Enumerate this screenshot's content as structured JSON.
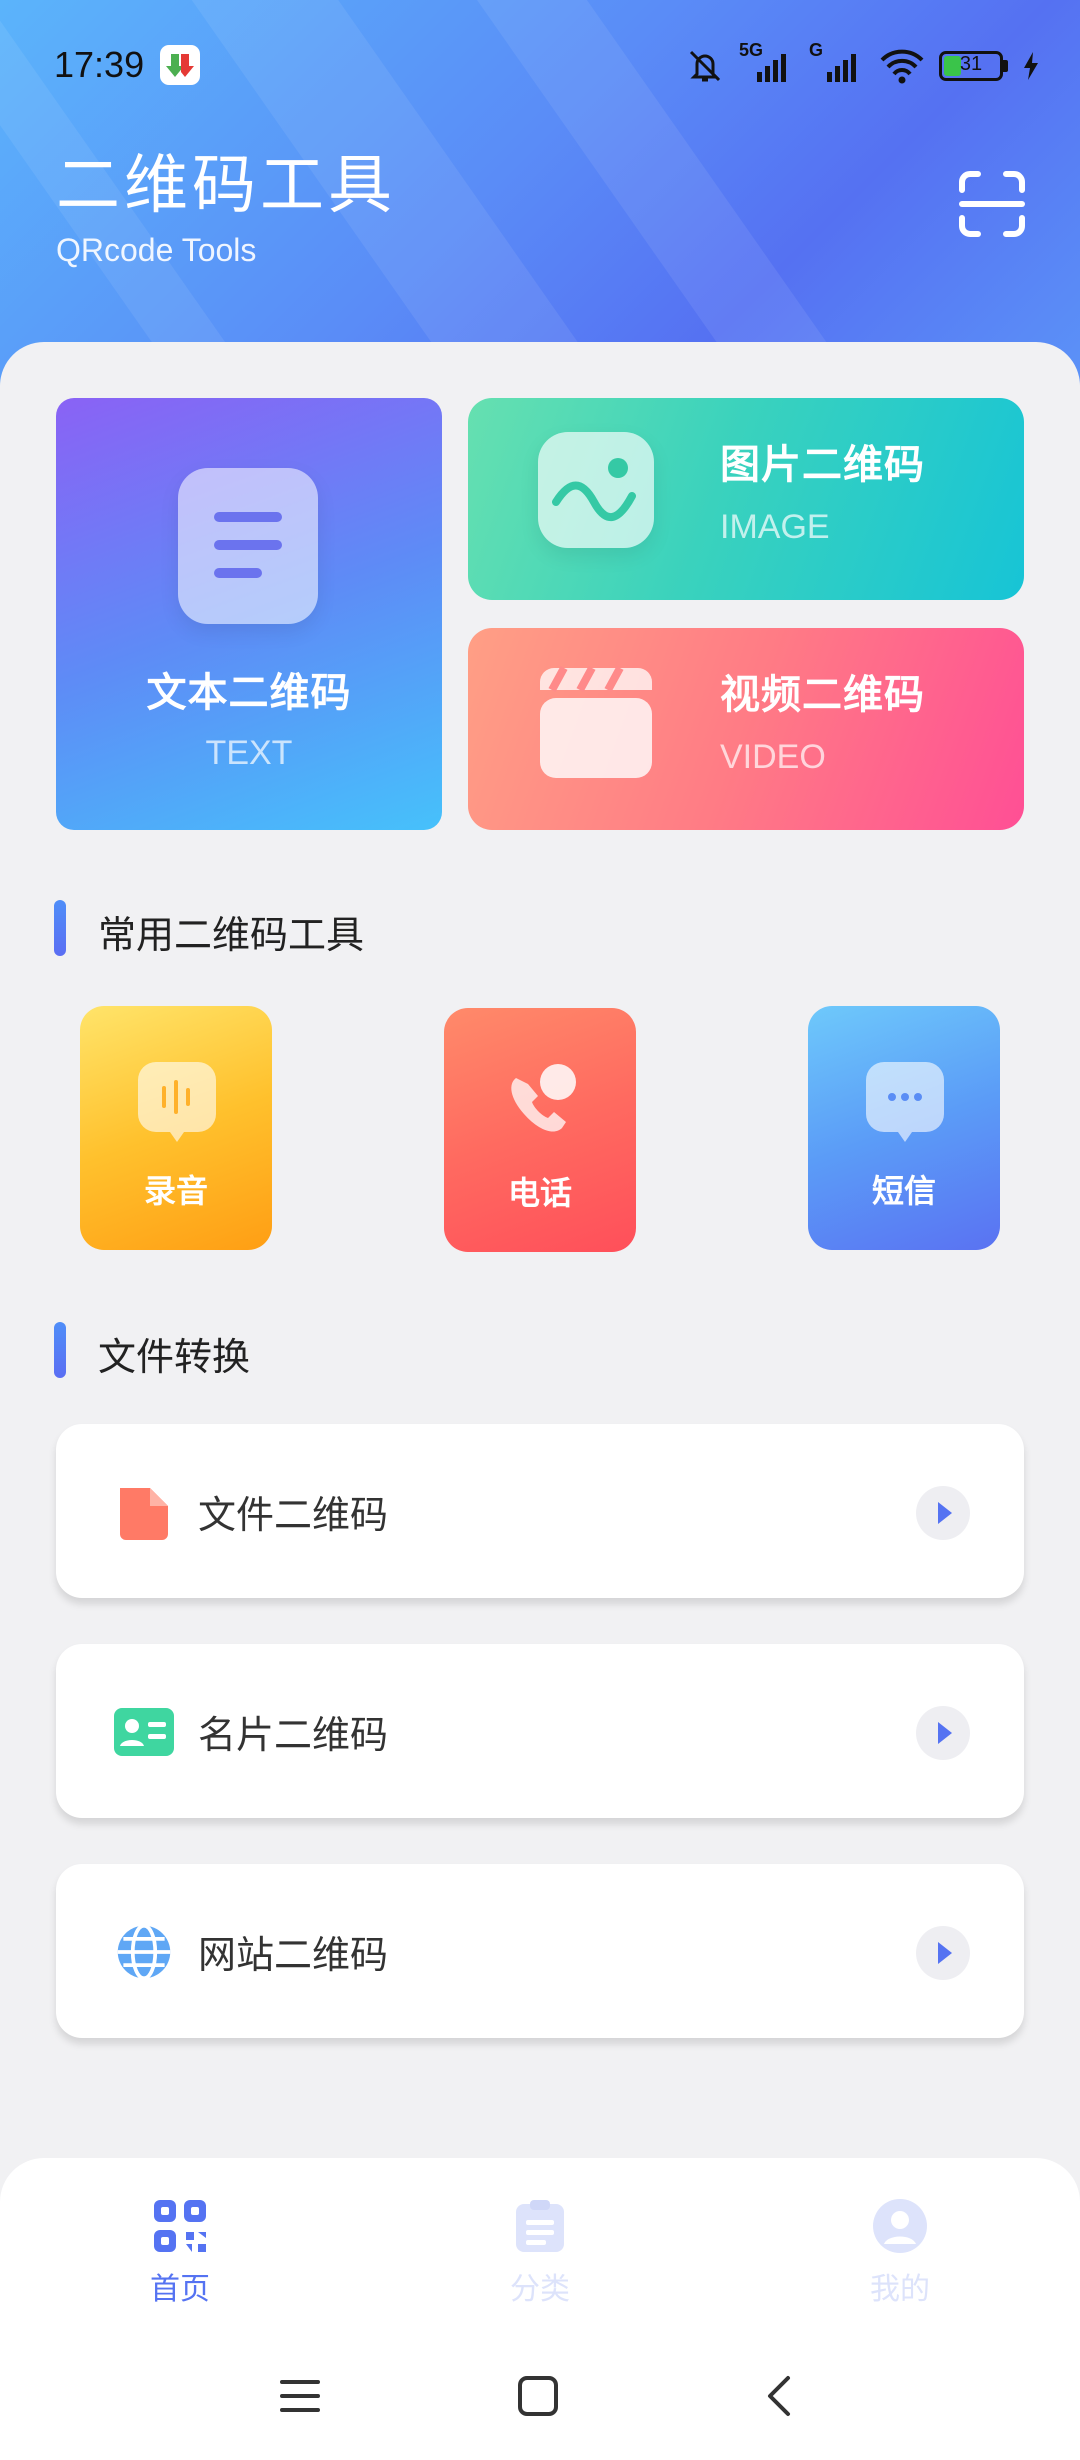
{
  "status_bar": {
    "time": "17:39",
    "network_5g": "5G",
    "network_g": "G",
    "battery": "31"
  },
  "header": {
    "title": "二维码工具",
    "subtitle": "QRcode Tools",
    "scan_icon": "scan-icon"
  },
  "feature_cards": {
    "text": {
      "label": "文本二维码",
      "sub": "TEXT",
      "icon": "document-lines-icon"
    },
    "image": {
      "label": "图片二维码",
      "sub": "IMAGE",
      "icon": "image-icon"
    },
    "video": {
      "label": "视频二维码",
      "sub": "VIDEO",
      "icon": "clapperboard-icon"
    }
  },
  "common_tools": {
    "title": "常用二维码工具",
    "items": [
      {
        "label": "录音",
        "icon": "voice-recording-icon"
      },
      {
        "label": "电话",
        "icon": "phone-call-icon"
      },
      {
        "label": "短信",
        "icon": "message-bubble-icon"
      }
    ]
  },
  "file_conversion": {
    "title": "文件转换",
    "items": [
      {
        "label": "文件二维码",
        "icon": "file-icon"
      },
      {
        "label": "名片二维码",
        "icon": "business-card-icon"
      },
      {
        "label": "网站二维码",
        "icon": "globe-icon"
      }
    ]
  },
  "bottom_nav": {
    "items": [
      {
        "label": "首页",
        "icon": "qrcode-home-icon",
        "active": true
      },
      {
        "label": "分类",
        "icon": "clipboard-list-icon",
        "active": false
      },
      {
        "label": "我的",
        "icon": "user-avatar-icon",
        "active": false
      }
    ]
  },
  "colors": {
    "accent": "#5573f2",
    "inactive_nav": "#dde3fb",
    "header_gradient_start": "#5bb4fb",
    "header_gradient_end": "#5571f2"
  }
}
